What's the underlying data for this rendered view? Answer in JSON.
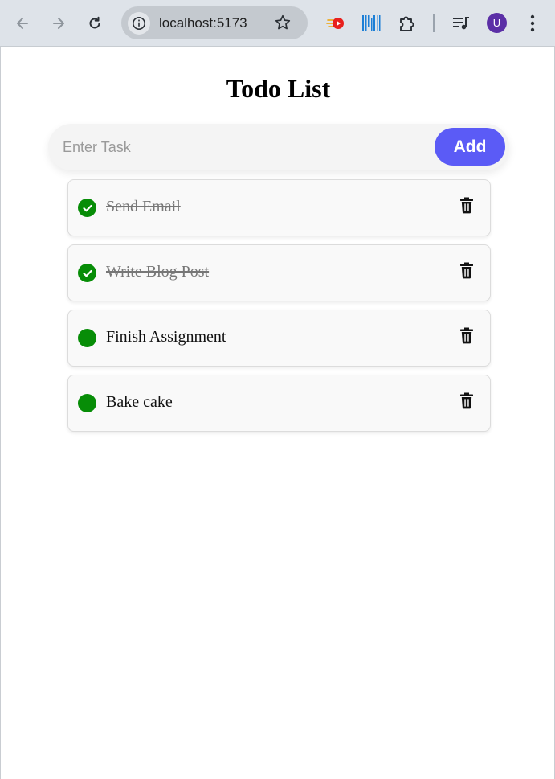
{
  "browser": {
    "url": "localhost:5173",
    "avatar_letter": "U"
  },
  "app": {
    "title": "Todo List",
    "input": {
      "placeholder": "Enter Task",
      "value": ""
    },
    "add_label": "Add",
    "accent_color": "#5b5bf6",
    "check_color": "#078d07",
    "todos": [
      {
        "text": "Send Email",
        "done": true
      },
      {
        "text": "Write Blog Post",
        "done": true
      },
      {
        "text": "Finish Assignment",
        "done": false
      },
      {
        "text": "Bake cake",
        "done": false
      }
    ]
  }
}
